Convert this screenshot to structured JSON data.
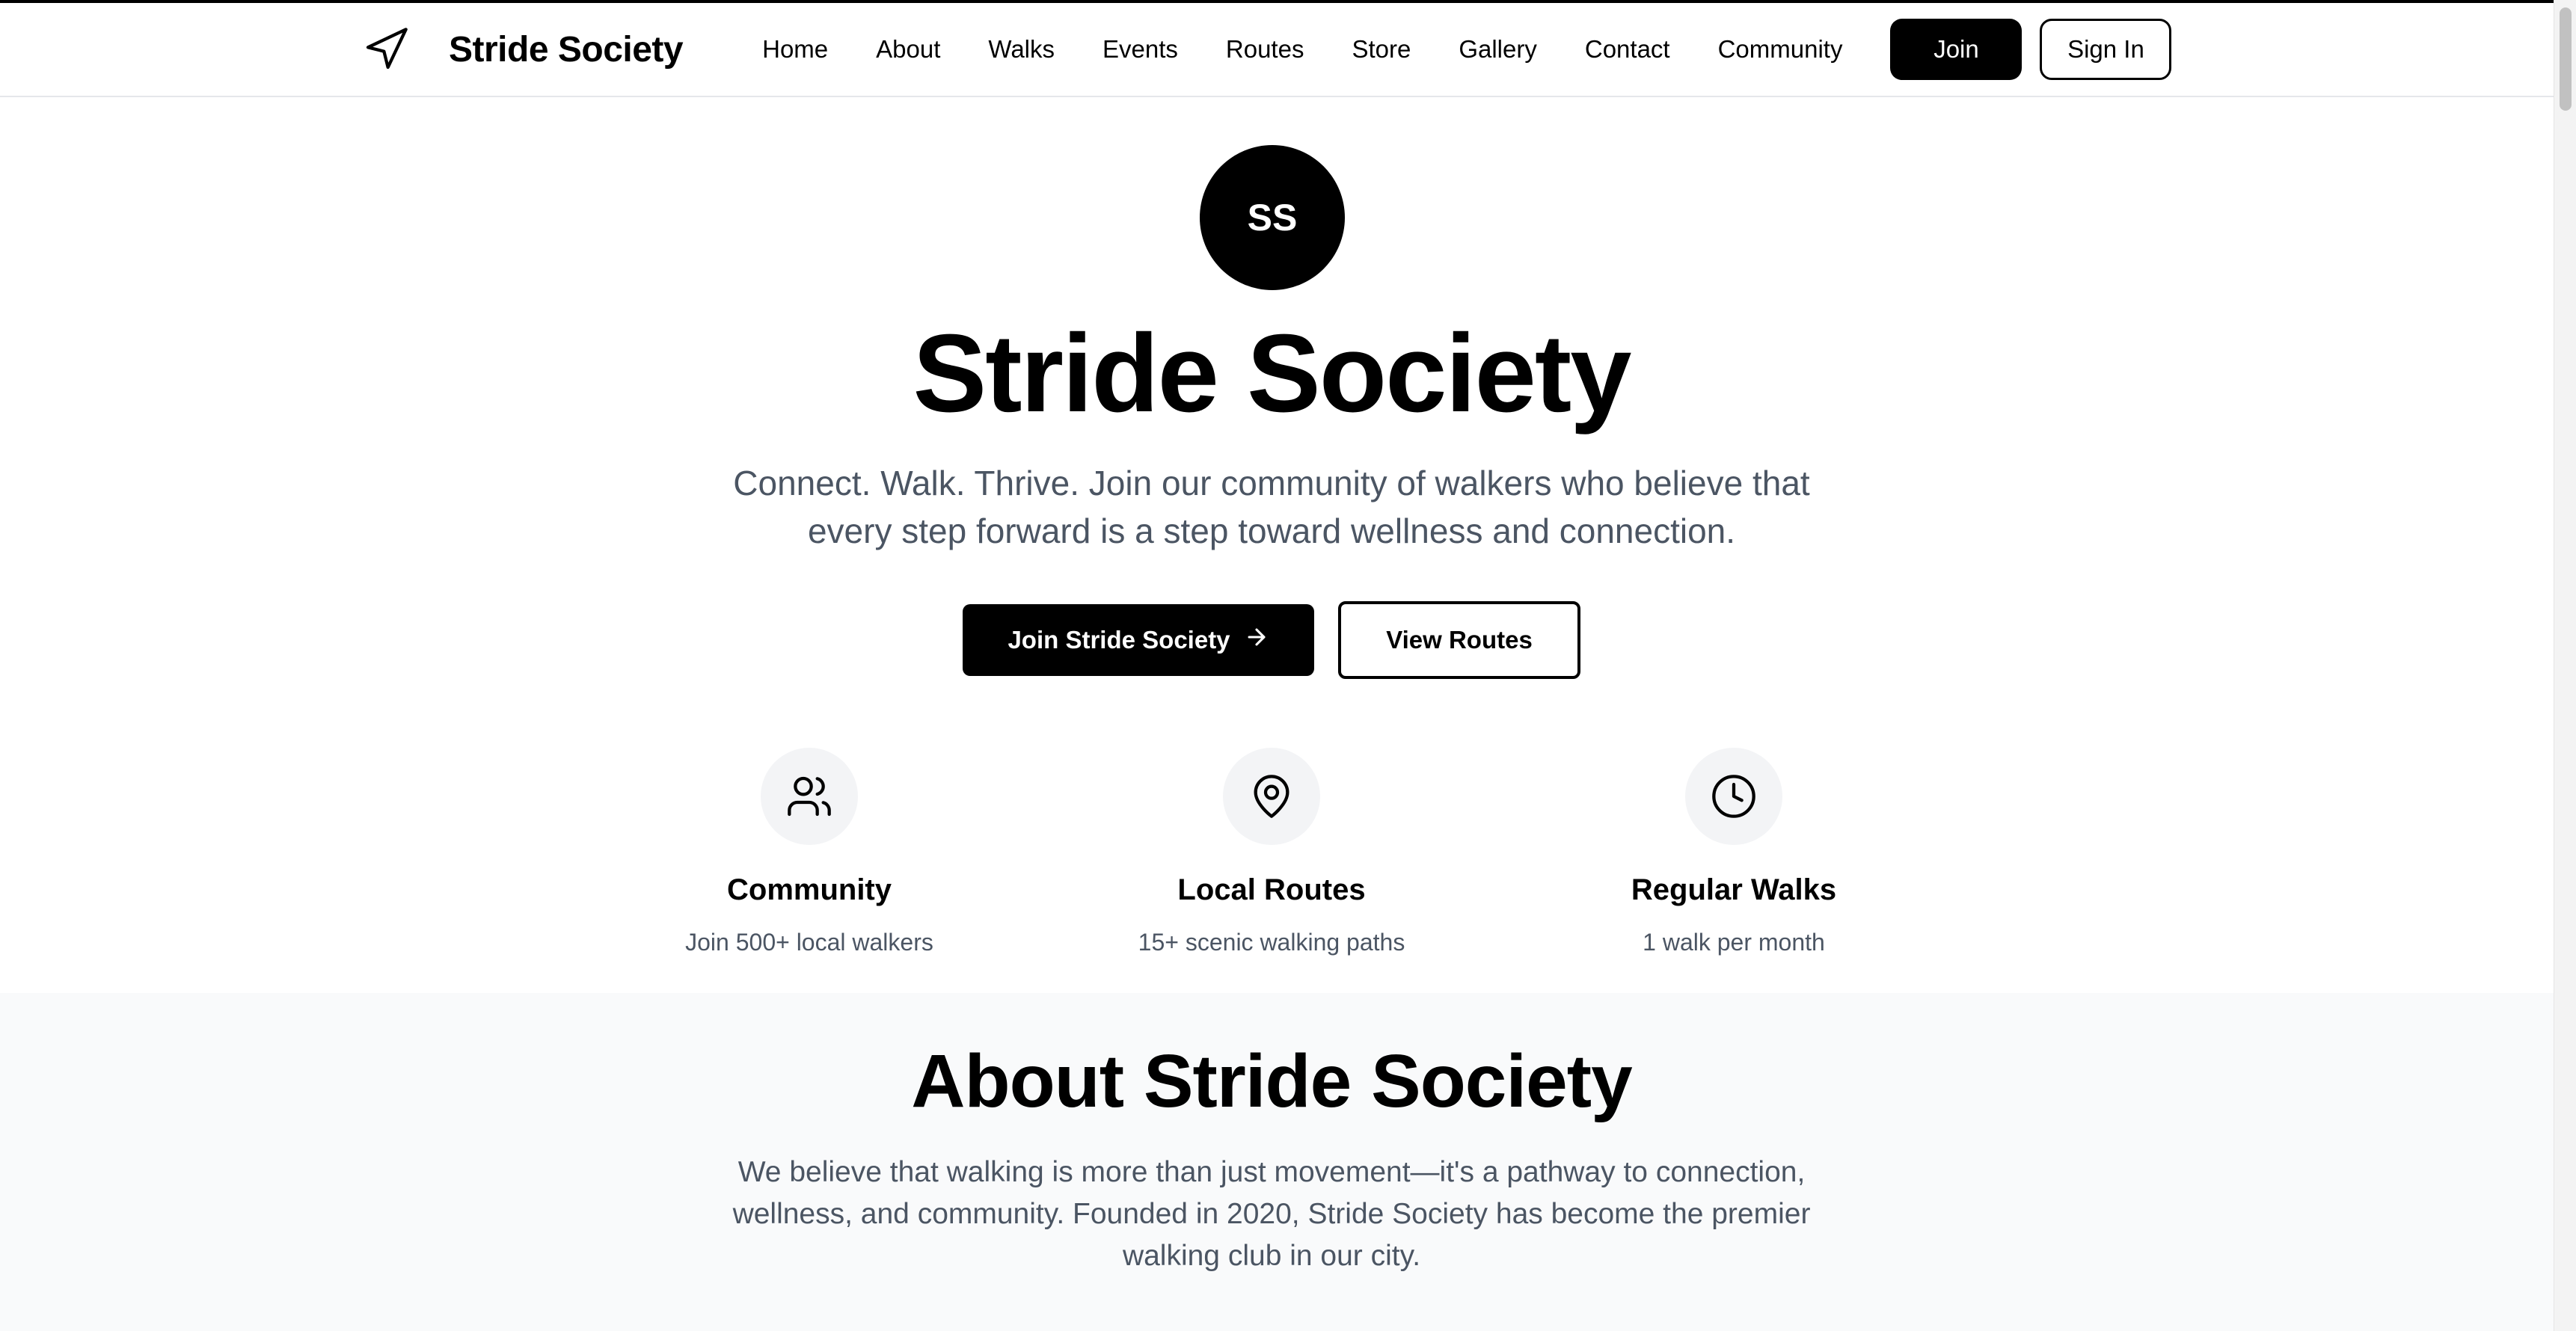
{
  "brand": {
    "name": "Stride Society",
    "icon": "navigation-arrow-icon"
  },
  "nav": {
    "links": [
      "Home",
      "About",
      "Walks",
      "Events",
      "Routes",
      "Store",
      "Gallery",
      "Contact",
      "Community"
    ],
    "join_label": "Join",
    "signin_label": "Sign In"
  },
  "hero": {
    "logo_initials": "SS",
    "title": "Stride Society",
    "subtitle": "Connect. Walk. Thrive. Join our community of walkers who believe that every step forward is a step toward wellness and connection.",
    "primary_cta": "Join Stride Society",
    "secondary_cta": "View Routes"
  },
  "features": [
    {
      "icon": "users-icon",
      "title": "Community",
      "desc": "Join 500+ local walkers"
    },
    {
      "icon": "map-pin-icon",
      "title": "Local Routes",
      "desc": "15+ scenic walking paths"
    },
    {
      "icon": "clock-icon",
      "title": "Regular Walks",
      "desc": "1 walk per month"
    }
  ],
  "about": {
    "title": "About Stride Society",
    "text": "We believe that walking is more than just movement—it's a pathway to connection, wellness, and community. Founded in 2020, Stride Society has become the premier walking club in our city."
  },
  "colors": {
    "primary": "#000000",
    "muted_text": "#4b5563",
    "icon_bg": "#f3f4f6",
    "section_bg": "#f9fafb"
  }
}
